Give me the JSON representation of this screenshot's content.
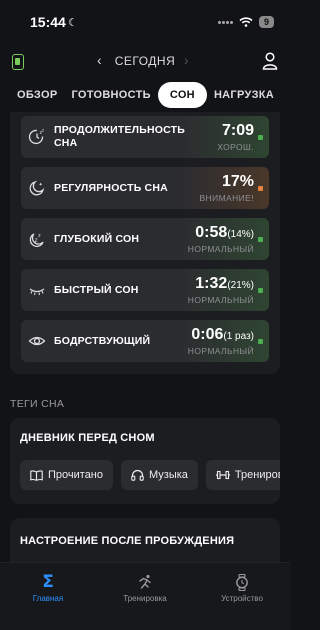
{
  "status_bar": {
    "time": "15:44",
    "battery": "9"
  },
  "header": {
    "date": "СЕГОДНЯ"
  },
  "tabs": [
    {
      "label": "ОБЗОР",
      "active": false
    },
    {
      "label": "ГОТОВНОСТЬ",
      "active": false
    },
    {
      "label": "СОН",
      "active": true
    },
    {
      "label": "НАГРУЗКА",
      "active": false
    }
  ],
  "metrics": [
    {
      "name": "ПРОДОЛЖИТЕЛЬНОСТЬ СНА",
      "value": "7:09",
      "extra": "",
      "status": "ХОРОШ.",
      "color": "#4caf50",
      "icon": "sleep-duration-icon"
    },
    {
      "name": "РЕГУЛЯРНОСТЬ СНА",
      "value": "17%",
      "extra": "",
      "status": "ВНИМАНИЕ!",
      "color": "#e8823a",
      "icon": "sleep-regularity-icon"
    },
    {
      "name": "ГЛУБОКИЙ СОН",
      "value": "0:58",
      "extra": "(14%)",
      "status": "НОРМАЛЬНЫЙ",
      "color": "#4caf50",
      "icon": "deep-sleep-icon"
    },
    {
      "name": "БЫСТРЫЙ СОН",
      "value": "1:32",
      "extra": "(21%)",
      "status": "НОРМАЛЬНЫЙ",
      "color": "#4caf50",
      "icon": "rem-sleep-icon"
    },
    {
      "name": "БОДРСТВУЮЩИЙ",
      "value": "0:06",
      "extra": "(1 раз)",
      "status": "НОРМАЛЬНЫЙ",
      "color": "#4caf50",
      "icon": "awake-eye-icon"
    }
  ],
  "tags": {
    "title": "ТЕГИ СНА",
    "diary": {
      "title": "ДНЕВНИК ПЕРЕД СНОМ",
      "chips": [
        {
          "label": "Прочитано",
          "icon": "book-icon"
        },
        {
          "label": "Музыка",
          "icon": "headphones-icon"
        },
        {
          "label": "Трениров",
          "icon": "dumbbell-icon"
        }
      ]
    },
    "mood": {
      "title": "НАСТРОЕНИЕ ПОСЛЕ ПРОБУЖДЕНИЯ"
    }
  },
  "bottom_nav": [
    {
      "label": "Главная",
      "icon": "sigma-home-icon",
      "active": true
    },
    {
      "label": "Тренировка",
      "icon": "running-icon",
      "active": false
    },
    {
      "label": "Устройство",
      "icon": "watch-icon",
      "active": false
    }
  ],
  "colors": {
    "accent": "#2f8fff",
    "good": "#4caf50",
    "warning": "#e8823a"
  }
}
